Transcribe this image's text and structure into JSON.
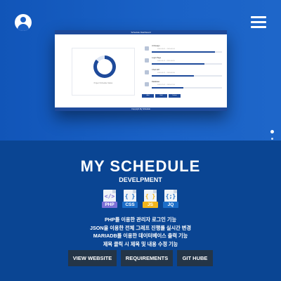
{
  "header": {
    "user_icon": "user-circle-icon",
    "menu_icon": "hamburger-menu-icon"
  },
  "preview": {
    "window_title": "Schedule Dashboard",
    "donut_caption": "Project Schedule Status",
    "donut_progress": 0.86,
    "tasks": [
      {
        "title": "UI Design",
        "date": "2020-06-01 ~ 2020-06-10",
        "progress": 0.9
      },
      {
        "title": "Login Page",
        "date": "2020-06-11 ~ 2020-06-20",
        "progress": 0.75
      },
      {
        "title": "Chart API",
        "date": "2020-06-21 ~ 2020-06-30",
        "progress": 0.6
      },
      {
        "title": "Database",
        "date": "2020-07-01 ~ 2020-07-10",
        "progress": 0.45
      }
    ],
    "buttons": [
      "Add",
      "Edit",
      "Delete"
    ],
    "footer": "Copyright My Schedule"
  },
  "pager": {
    "count": 4,
    "active": 0
  },
  "section": {
    "title": "MY SCHEDULE",
    "subtitle": "DEVELPMENT"
  },
  "technologies": [
    {
      "name": "PHP",
      "symbol": "</>",
      "color": "#7b6fd6",
      "icon": "php-file-icon"
    },
    {
      "name": "CSS",
      "symbol": "{ }",
      "color": "#1c6ec9",
      "icon": "css-file-icon"
    },
    {
      "name": "JS",
      "symbol": "{ }",
      "color": "#f2b51b",
      "icon": "js-file-icon"
    },
    {
      "name": "JQ",
      "symbol": "{;}",
      "color": "#1c6ec9",
      "icon": "jquery-file-icon"
    }
  ],
  "features": [
    "PHP를 이용한 관리자 로그인 기능",
    "JSON을 이용한 전체 그래프 진행률 실시간 변경",
    "MARIADB를 이용한 데이터베이스 출력 기능",
    "제목 클릭 시 제목 및 내용 수정 기능"
  ],
  "buttons": {
    "view_website": "VIEW WEBSITE",
    "requirements": "REQUIREMENTS",
    "git_hub": "GIT HUBE"
  },
  "colors": {
    "hero_blue": "#1a62c7",
    "section_blue": "#0a4593",
    "button_bg": "#243547"
  }
}
